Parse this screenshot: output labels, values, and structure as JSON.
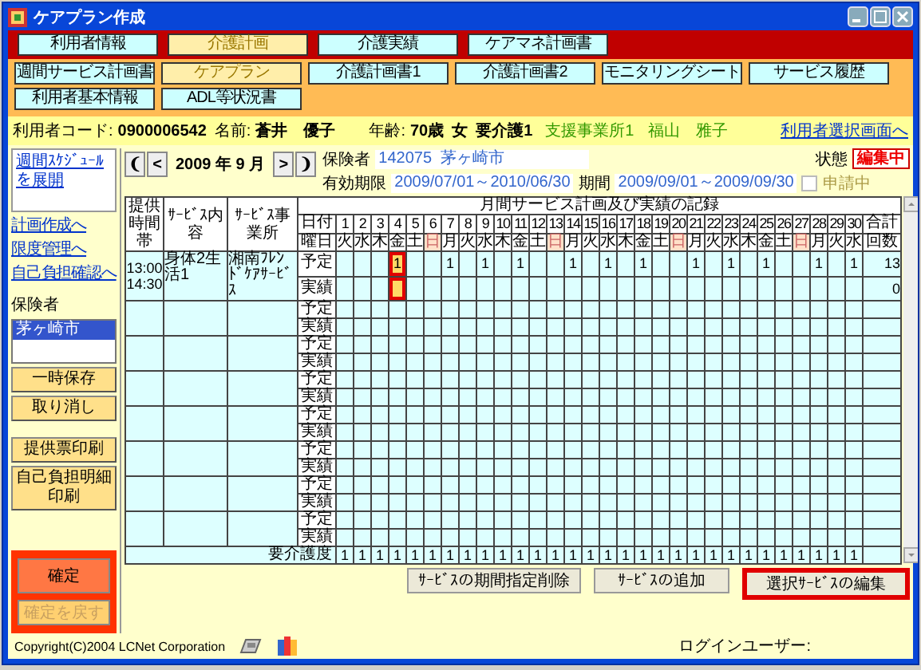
{
  "window": {
    "title": "ケアプラン作成"
  },
  "main_tabs": [
    {
      "label": "利用者情報",
      "selected": false
    },
    {
      "label": "介護計画",
      "selected": true
    },
    {
      "label": "介護実績",
      "selected": false
    },
    {
      "label": "ケアマネ計画書",
      "selected": false
    }
  ],
  "sub_tabs": [
    {
      "label": "週間サービス計画書",
      "selected": false
    },
    {
      "label": "ケアプラン",
      "selected": true
    },
    {
      "label": "介護計画書1",
      "selected": false
    },
    {
      "label": "介護計画書2",
      "selected": false
    },
    {
      "label": "モニタリングシート",
      "selected": false
    },
    {
      "label": "サービス履歴",
      "selected": false
    },
    {
      "label": "利用者基本情報",
      "selected": false
    },
    {
      "label": "ADL等状況書",
      "selected": false
    }
  ],
  "client": {
    "code_label": "利用者コード:",
    "code": "0900006542",
    "name_label": "名前:",
    "name": "蒼井　優子",
    "age_label": "年齢:",
    "age": "70歳",
    "sex": "女",
    "care_level": "要介護1",
    "office": "支援事業所1",
    "manager": "福山　雅子",
    "back_link": "利用者選択画面へ"
  },
  "sidebar": {
    "schedule_link": "週間ｽｹｼﾞｭｰﾙを展開",
    "links": [
      "計画作成へ",
      "限度管理へ",
      "自己負担確認へ"
    ],
    "insurer_label": "保険者",
    "insurers": [
      {
        "label": "茅ヶ崎市",
        "selected": true
      }
    ],
    "buttons": [
      "一時保存",
      "取り消し",
      "提供票印刷",
      "自己負担明細印刷"
    ],
    "confirm_buttons": [
      {
        "label": "確定",
        "disabled": false
      },
      {
        "label": "確定を戻す",
        "disabled": true
      }
    ]
  },
  "month_nav": {
    "first": "❨",
    "prev": "<",
    "month": "2009 年 9 月",
    "next": ">",
    "last": "❩"
  },
  "insurer": {
    "label": "保険者",
    "number": "142075",
    "name": "茅ヶ崎市"
  },
  "valid": {
    "label": "有効期限",
    "value": "2009/07/01～2010/06/30"
  },
  "period": {
    "label": "期間",
    "value": "2009/09/01～2009/09/30"
  },
  "applying": {
    "label": "申請中",
    "checked": false,
    "disabled": true
  },
  "status": {
    "label": "状態",
    "value": "編集中"
  },
  "grid": {
    "title": "月間サービス計画及び実績の記録",
    "columns": [
      "提供時間帯",
      "ｻｰﾋﾞｽ内容",
      "ｻｰﾋﾞｽ事業所"
    ],
    "date_label": "日付",
    "weekday_label": "曜日",
    "total_label": "合計",
    "count_label": "回数",
    "days": [
      {
        "num": "1",
        "weekday": "火",
        "holiday": false
      },
      {
        "num": "2",
        "weekday": "水",
        "holiday": false
      },
      {
        "num": "3",
        "weekday": "木",
        "holiday": false
      },
      {
        "num": "4",
        "weekday": "金",
        "holiday": false
      },
      {
        "num": "5",
        "weekday": "土",
        "holiday": false
      },
      {
        "num": "6",
        "weekday": "日",
        "holiday": true
      },
      {
        "num": "7",
        "weekday": "月",
        "holiday": false
      },
      {
        "num": "8",
        "weekday": "火",
        "holiday": false
      },
      {
        "num": "9",
        "weekday": "水",
        "holiday": false
      },
      {
        "num": "10",
        "weekday": "木",
        "holiday": false
      },
      {
        "num": "11",
        "weekday": "金",
        "holiday": false
      },
      {
        "num": "12",
        "weekday": "土",
        "holiday": false
      },
      {
        "num": "13",
        "weekday": "日",
        "holiday": true
      },
      {
        "num": "14",
        "weekday": "月",
        "holiday": false
      },
      {
        "num": "15",
        "weekday": "火",
        "holiday": false
      },
      {
        "num": "16",
        "weekday": "水",
        "holiday": false
      },
      {
        "num": "17",
        "weekday": "木",
        "holiday": false
      },
      {
        "num": "18",
        "weekday": "金",
        "holiday": false
      },
      {
        "num": "19",
        "weekday": "土",
        "holiday": false
      },
      {
        "num": "20",
        "weekday": "日",
        "holiday": true
      },
      {
        "num": "21",
        "weekday": "月",
        "holiday": false
      },
      {
        "num": "22",
        "weekday": "火",
        "holiday": false
      },
      {
        "num": "23",
        "weekday": "水",
        "holiday": false
      },
      {
        "num": "24",
        "weekday": "木",
        "holiday": false
      },
      {
        "num": "25",
        "weekday": "金",
        "holiday": false
      },
      {
        "num": "26",
        "weekday": "土",
        "holiday": false
      },
      {
        "num": "27",
        "weekday": "日",
        "holiday": true
      },
      {
        "num": "28",
        "weekday": "月",
        "holiday": false
      },
      {
        "num": "29",
        "weekday": "火",
        "holiday": false
      },
      {
        "num": "30",
        "weekday": "水",
        "holiday": false
      }
    ],
    "services": [
      {
        "start": "13:00",
        "end": "14:30",
        "content": "身体2生活1",
        "provider": "湘南ﾌﾚﾝﾄﾞｹｱｻｰﾋﾞｽ",
        "plan_label": "予定",
        "actual_label": "実績",
        "plan": [
          {
            "kind": "blank",
            "selected": false
          },
          {
            "kind": "blank",
            "selected": false
          },
          {
            "kind": "blank",
            "selected": false
          },
          {
            "kind": "count",
            "text": "1",
            "selected": true
          },
          {
            "kind": "blank",
            "selected": false
          },
          {
            "kind": "blank",
            "selected": false
          },
          {
            "kind": "count",
            "text": "1",
            "selected": false
          },
          {
            "kind": "blank",
            "selected": false
          },
          {
            "kind": "count",
            "text": "1",
            "selected": false
          },
          {
            "kind": "blank",
            "selected": false
          },
          {
            "kind": "count",
            "text": "1",
            "selected": false
          },
          {
            "kind": "blank",
            "selected": false
          },
          {
            "kind": "blank",
            "selected": false
          },
          {
            "kind": "count",
            "text": "1",
            "selected": false
          },
          {
            "kind": "blank",
            "selected": false
          },
          {
            "kind": "count",
            "text": "1",
            "selected": false
          },
          {
            "kind": "blank",
            "selected": false
          },
          {
            "kind": "count",
            "text": "1",
            "selected": false
          },
          {
            "kind": "blank",
            "selected": false
          },
          {
            "kind": "blank",
            "selected": false
          },
          {
            "kind": "count",
            "text": "1",
            "selected": false
          },
          {
            "kind": "blank",
            "selected": false
          },
          {
            "kind": "count",
            "text": "1",
            "selected": false
          },
          {
            "kind": "blank",
            "selected": false
          },
          {
            "kind": "count",
            "text": "1",
            "selected": false
          },
          {
            "kind": "blank",
            "selected": false
          },
          {
            "kind": "blank",
            "selected": false
          },
          {
            "kind": "count",
            "text": "1",
            "selected": false
          },
          {
            "kind": "blank",
            "selected": false
          },
          {
            "kind": "count",
            "text": "1",
            "selected": false
          }
        ],
        "plan_total": "13",
        "actual_total": "0"
      },
      {
        "plan_label": "予定",
        "actual_label": "実績"
      },
      {
        "plan_label": "予定",
        "actual_label": "実績"
      },
      {
        "plan_label": "予定",
        "actual_label": "実績"
      },
      {
        "plan_label": "予定",
        "actual_label": "実績"
      },
      {
        "plan_label": "予定",
        "actual_label": "実績"
      },
      {
        "plan_label": "予定",
        "actual_label": "実績"
      },
      {
        "plan_label": "予定",
        "actual_label": "実績"
      }
    ],
    "care_row": {
      "label": "要介護度",
      "values": [
        "1",
        "1",
        "1",
        "1",
        "1",
        "1",
        "1",
        "1",
        "1",
        "1",
        "1",
        "1",
        "1",
        "1",
        "1",
        "1",
        "1",
        "1",
        "1",
        "1",
        "1",
        "1",
        "1",
        "1",
        "1",
        "1",
        "1",
        "1",
        "1",
        "1"
      ]
    }
  },
  "actions": [
    {
      "label": "ｻｰﾋﾞｽの期間指定削除",
      "highlighted": false
    },
    {
      "label": "ｻｰﾋﾞｽの追加",
      "highlighted": false
    },
    {
      "label": "選択ｻｰﾋﾞｽの編集",
      "highlighted": true
    }
  ],
  "footer": {
    "copyright": "Copyright(C)2004 LCNet Corporation",
    "login_label": "ログインユーザー:"
  }
}
